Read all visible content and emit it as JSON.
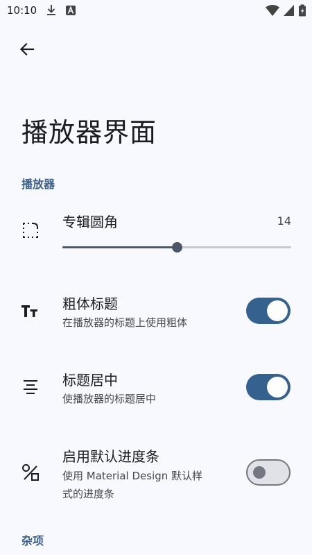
{
  "status_bar": {
    "time": "10:10",
    "icons": [
      "download-icon",
      "a-badge-icon",
      "wifi-icon",
      "signal-icon",
      "battery-icon"
    ]
  },
  "header": {
    "back_icon": "arrow-back-icon",
    "title": "播放器界面"
  },
  "sections": [
    {
      "header": "播放器",
      "items": [
        {
          "type": "slider",
          "icon": "rounded-corner-icon",
          "title": "专辑圆角",
          "value": "14",
          "progress": 0.5
        },
        {
          "type": "switch",
          "icon": "text-fields-icon",
          "title": "粗体标题",
          "summary": "在播放器的标题上使用粗体",
          "checked": true
        },
        {
          "type": "switch",
          "icon": "format-align-center-icon",
          "title": "标题居中",
          "summary": "使播放器的标题居中",
          "checked": true
        },
        {
          "type": "switch",
          "icon": "shapes-icon",
          "title": "启用默认进度条",
          "summary_line1": "使用 Material Design 默认样",
          "summary_line2": "式的进度条",
          "checked": false
        }
      ]
    },
    {
      "header": "杂项"
    }
  ],
  "colors": {
    "background": "#f8f9ff",
    "accent": "#35618e",
    "section_header": "#3d5f8a",
    "text_primary": "#1b1c1f",
    "text_secondary": "#44474e"
  }
}
